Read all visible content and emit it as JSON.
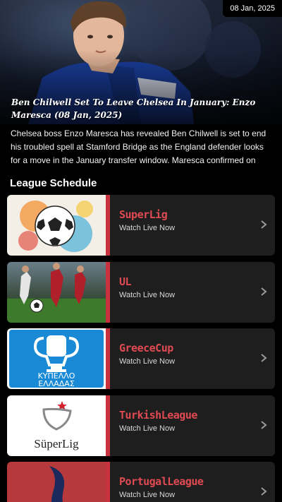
{
  "article": {
    "date": "08 Jan, 2025",
    "title": "Ben Chilwell Set To Leave Chelsea In January: Enzo Maresca (08 Jan, 2025)",
    "summary": "Chelsea boss Enzo Maresca has revealed Ben Chilwell is set to end his troubled spell at Stamford Bridge as the England defender looks for a move in the January transfer window. Maresca confirmed on Friday..."
  },
  "section": {
    "title": "League Schedule"
  },
  "leagues": [
    {
      "name": "SuperLig",
      "subtitle": "Watch Live Now"
    },
    {
      "name": "UL",
      "subtitle": "Watch Live Now"
    },
    {
      "name": "GreeceCup",
      "subtitle": "Watch Live Now",
      "logo_text_1": "ΚΥΠΕΛΛΟ",
      "logo_text_2": "ΕΛΛΑΔΑΣ"
    },
    {
      "name": "TurkishLeague",
      "subtitle": "Watch Live Now",
      "logo_text": "SüperLig"
    },
    {
      "name": "PortugalLeague",
      "subtitle": "Watch Live Now"
    }
  ],
  "colors": {
    "accent": "#c8323e",
    "league_name": "#e04a52",
    "card_bg": "#1e1e1e",
    "background": "#000000"
  },
  "icons": {
    "row_arrow": "chevron-right-icon"
  }
}
